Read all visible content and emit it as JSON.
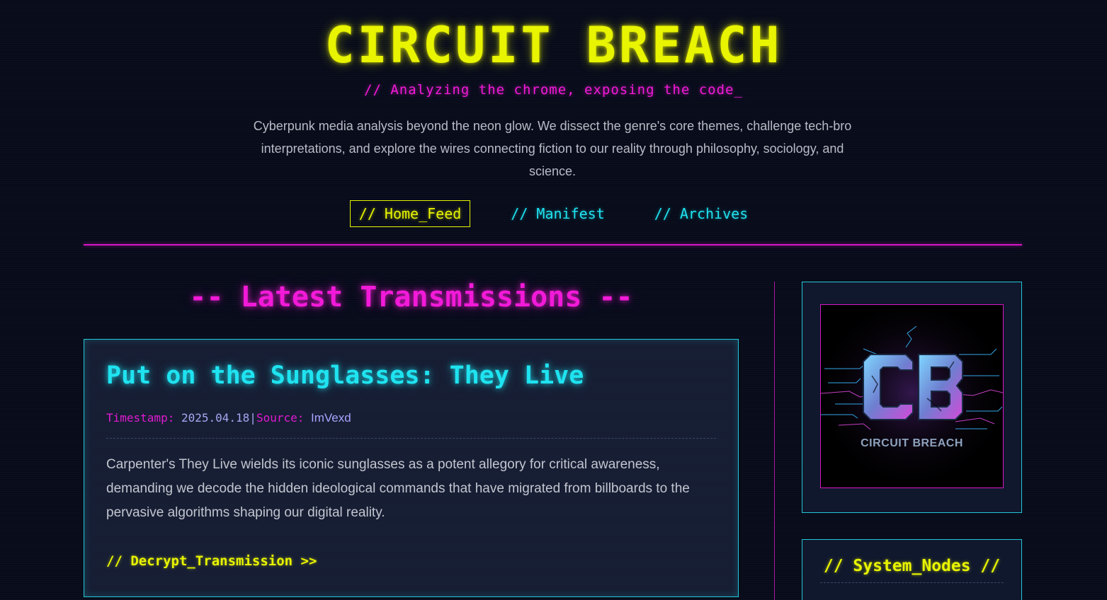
{
  "header": {
    "title": "CIRCUIT BREACH",
    "tagline": "// Analyzing the chrome, exposing the code_",
    "intro": "Cyberpunk media analysis beyond the neon glow. We dissect the genre's core themes, challenge tech-bro interpretations, and explore the wires connecting fiction to our reality through philosophy, sociology, and science."
  },
  "nav": {
    "items": [
      {
        "label": "// Home_Feed",
        "active": true
      },
      {
        "label": "// Manifest",
        "active": false
      },
      {
        "label": "// Archives",
        "active": false
      }
    ]
  },
  "main": {
    "section_heading": "-- Latest Transmissions --",
    "posts": [
      {
        "title": "Put on the Sunglasses: They Live",
        "timestamp_label": "Timestamp:",
        "timestamp": "2025.04.18",
        "separator": "|",
        "source_label": "Source:",
        "source": "ImVexd",
        "excerpt": "Carpenter's They Live wields its iconic sunglasses as a potent allegory for critical awareness, demanding we decode the hidden ideological commands that have migrated from billboards to the pervasive algorithms shaping our digital reality.",
        "read_more": "// Decrypt_Transmission >>"
      }
    ]
  },
  "sidebar": {
    "logo_caption": "CIRCUIT BREACH",
    "nodes_title": "// System_Nodes //"
  },
  "colors": {
    "background": "#070b1a",
    "neon_yellow": "#e8f400",
    "neon_magenta": "#f21ad8",
    "neon_cyan": "#1fe3f0",
    "card_border": "#22c6d6"
  }
}
